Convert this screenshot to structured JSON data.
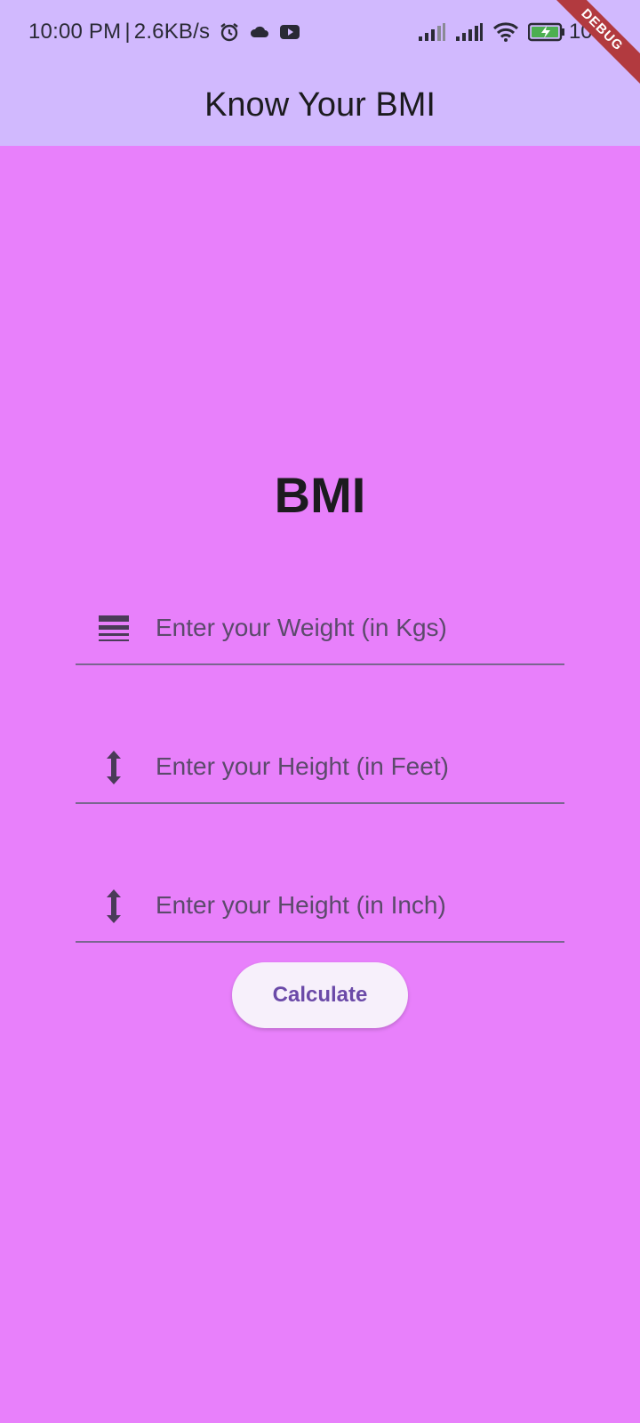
{
  "status_bar": {
    "time": "10:00 PM",
    "separator": "|",
    "net_speed": "2.6KB/s",
    "battery": "100",
    "icons": [
      "alarm-icon",
      "cloud-icon",
      "youtube-icon",
      "signal-icon",
      "signal-icon",
      "wifi-icon",
      "battery-charging-icon"
    ]
  },
  "debug_banner": "DEBUG",
  "app_bar": {
    "title": "Know Your BMI",
    "background": "#d1b9fe"
  },
  "main": {
    "background": "#e880fb",
    "heading": "BMI",
    "fields": [
      {
        "icon": "line-weight-icon",
        "placeholder": "Enter your Weight (in Kgs)",
        "value": ""
      },
      {
        "icon": "height-icon",
        "placeholder": "Enter your Height (in Feet)",
        "value": ""
      },
      {
        "icon": "height-icon",
        "placeholder": "Enter your Height (in Inch)",
        "value": ""
      }
    ],
    "button_label": "Calculate"
  }
}
